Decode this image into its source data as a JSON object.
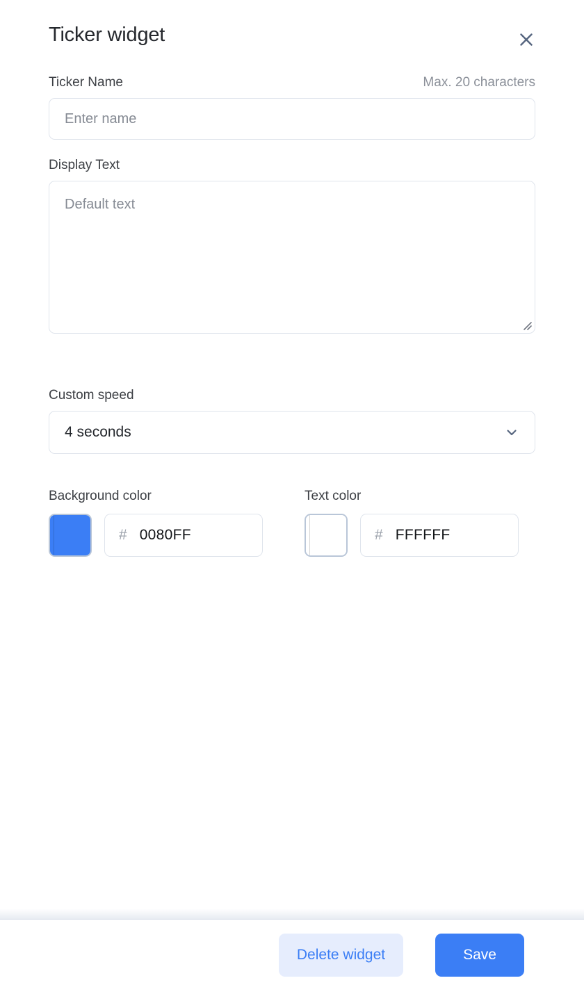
{
  "dialog": {
    "title": "Ticker widget",
    "close_icon": "close-icon"
  },
  "fields": {
    "ticker_name": {
      "label": "Ticker Name",
      "hint": "Max. 20 characters",
      "value": "",
      "placeholder": "Enter name"
    },
    "display_text": {
      "label": "Display Text",
      "value": "",
      "placeholder": "Default text",
      "resize_handle_icon": "resize-grip-icon"
    },
    "custom_speed": {
      "label": "Custom speed",
      "selected": "4 seconds",
      "chevron_icon": "chevron-down-icon"
    }
  },
  "colors": {
    "background": {
      "label": "Background color",
      "swatch_hex": "#3b7ef5",
      "hash": "#",
      "value": "0080FF"
    },
    "text": {
      "label": "Text color",
      "swatch_hex": "#ffffff",
      "hash": "#",
      "value": "FFFFFF"
    }
  },
  "footer": {
    "delete_label": "Delete widget",
    "save_label": "Save"
  },
  "theme": {
    "accent": "#3b7ef5",
    "accent_soft": "#e6edfd",
    "border": "#dfe4ec",
    "swatch_border": "#b9c6d8",
    "text_primary": "#25282d",
    "text_muted": "#8b9099",
    "icon_slate": "#56657f"
  }
}
